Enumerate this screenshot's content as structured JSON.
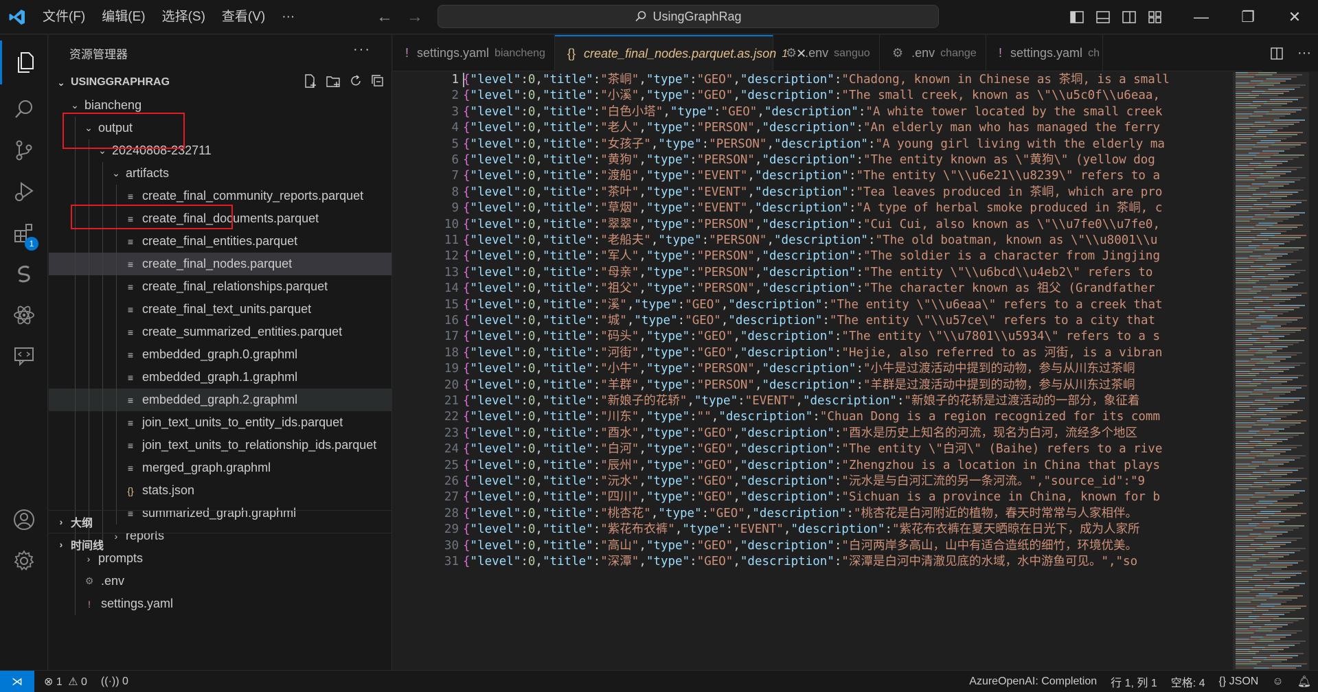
{
  "titlebar": {
    "menu": [
      "文件(F)",
      "编辑(E)",
      "选择(S)",
      "查看(V)",
      "···"
    ],
    "search_text": "UsingGraphRag"
  },
  "activity_bar": {
    "items": [
      "explorer-icon",
      "search-icon",
      "source-control-icon",
      "run-debug-icon",
      "extensions-icon",
      "remote-icon",
      "atom-icon",
      "comments-icon",
      "account-icon",
      "settings-gear-icon"
    ],
    "extensions_badge": "1",
    "accent_color": "#0078d4"
  },
  "sidebar": {
    "title": "资源管理器",
    "more": "···",
    "root": "USINGGRAPHRAG",
    "tree": [
      {
        "label": "biancheng",
        "type": "folder-open",
        "depth": 1
      },
      {
        "label": "output",
        "type": "folder-open",
        "depth": 2
      },
      {
        "label": "20240808-232711",
        "type": "folder-open",
        "depth": 3
      },
      {
        "label": "artifacts",
        "type": "folder-open",
        "depth": 4
      },
      {
        "label": "create_final_community_reports.parquet",
        "type": "file",
        "depth": 5
      },
      {
        "label": "create_final_documents.parquet",
        "type": "file",
        "depth": 5
      },
      {
        "label": "create_final_entities.parquet",
        "type": "file",
        "depth": 5
      },
      {
        "label": "create_final_nodes.parquet",
        "type": "file",
        "depth": 5,
        "selected": true
      },
      {
        "label": "create_final_relationships.parquet",
        "type": "file",
        "depth": 5
      },
      {
        "label": "create_final_text_units.parquet",
        "type": "file",
        "depth": 5
      },
      {
        "label": "create_summarized_entities.parquet",
        "type": "file",
        "depth": 5
      },
      {
        "label": "embedded_graph.0.graphml",
        "type": "file",
        "depth": 5
      },
      {
        "label": "embedded_graph.1.graphml",
        "type": "file",
        "depth": 5
      },
      {
        "label": "embedded_graph.2.graphml",
        "type": "file",
        "depth": 5,
        "hover": true
      },
      {
        "label": "join_text_units_to_entity_ids.parquet",
        "type": "file",
        "depth": 5
      },
      {
        "label": "join_text_units_to_relationship_ids.parquet",
        "type": "file",
        "depth": 5
      },
      {
        "label": "merged_graph.graphml",
        "type": "file",
        "depth": 5
      },
      {
        "label": "stats.json",
        "type": "json",
        "depth": 5
      },
      {
        "label": "summarized_graph.graphml",
        "type": "file",
        "depth": 5
      },
      {
        "label": "reports",
        "type": "folder-closed",
        "depth": 4
      },
      {
        "label": "prompts",
        "type": "folder-closed",
        "depth": 2
      },
      {
        "label": ".env",
        "type": "gear",
        "depth": 2
      },
      {
        "label": "settings.yaml",
        "type": "yaml",
        "depth": 2
      }
    ],
    "outline": "大纲",
    "timeline": "时间线"
  },
  "tabs": [
    {
      "icon": "!",
      "label": "settings.yaml",
      "desc": "biancheng",
      "active": false
    },
    {
      "icon": "{}",
      "label": "create_final_nodes.parquet.as.json",
      "desc": "1",
      "active": true
    },
    {
      "icon": "⚙",
      "label": ".env",
      "desc": "sanguo",
      "active": false
    },
    {
      "icon": "⚙",
      "label": ".env",
      "desc": "change",
      "active": false
    },
    {
      "icon": "!",
      "label": "settings.yaml",
      "desc": "ch",
      "active": false
    }
  ],
  "editor": {
    "lines": [
      {
        "n": "1",
        "title": "茶峒",
        "type": "GEO",
        "desc": "Chadong, known in Chinese as 茶垌, is a small"
      },
      {
        "n": "2",
        "title": "小溪",
        "type": "GEO",
        "desc": "The small creek, known as \\\"\\\\u5c0f\\\\u6eaa,"
      },
      {
        "n": "3",
        "title": "白色小塔",
        "type": "GEO",
        "desc": "A white tower located by the small creek"
      },
      {
        "n": "4",
        "title": "老人",
        "type": "PERSON",
        "desc": "An elderly man who has managed the ferry"
      },
      {
        "n": "5",
        "title": "女孩子",
        "type": "PERSON",
        "desc": "A young girl living with the elderly ma"
      },
      {
        "n": "6",
        "title": "黄狗",
        "type": "PERSON",
        "desc": "The entity known as \\\"黄狗\\\" (yellow dog"
      },
      {
        "n": "7",
        "title": "渡船",
        "type": "EVENT",
        "desc": "The entity \\\"\\\\u6e21\\\\u8239\\\" refers to a"
      },
      {
        "n": "8",
        "title": "茶叶",
        "type": "EVENT",
        "desc": "Tea leaves produced in 茶峒, which are pro"
      },
      {
        "n": "9",
        "title": "草烟",
        "type": "EVENT",
        "desc": "A type of herbal smoke produced in 茶峒, c"
      },
      {
        "n": "10",
        "title": "翠翠",
        "type": "PERSON",
        "desc": "Cui Cui, also known as \\\"\\\\u7fe0\\\\u7fe0,"
      },
      {
        "n": "11",
        "title": "老船夫",
        "type": "PERSON",
        "desc": "The old boatman, known as \\\"\\\\u8001\\\\u"
      },
      {
        "n": "12",
        "title": "军人",
        "type": "PERSON",
        "desc": "The soldier is a character from Jingjing"
      },
      {
        "n": "13",
        "title": "母亲",
        "type": "PERSON",
        "desc": "The entity \\\"\\\\u6bcd\\\\u4eb2\\\" refers to"
      },
      {
        "n": "14",
        "title": "祖父",
        "type": "PERSON",
        "desc": "The character known as 祖父 (Grandfather"
      },
      {
        "n": "15",
        "title": "溪",
        "type": "GEO",
        "desc": "The entity \\\"\\\\u6eaa\\\" refers to a creek that"
      },
      {
        "n": "16",
        "title": "城",
        "type": "GEO",
        "desc": "The entity \\\"\\\\u57ce\\\" refers to a city that"
      },
      {
        "n": "17",
        "title": "码头",
        "type": "GEO",
        "desc": "The entity \\\"\\\\u7801\\\\u5934\\\" refers to a s"
      },
      {
        "n": "18",
        "title": "河街",
        "type": "GEO",
        "desc": "Hejie, also referred to as 河街, is a vibran"
      },
      {
        "n": "19",
        "title": "小牛",
        "type": "PERSON",
        "desc": "小牛是过渡活动中提到的动物，参与从川东过茶峒"
      },
      {
        "n": "20",
        "title": "羊群",
        "type": "PERSON",
        "desc": "羊群是过渡活动中提到的动物，参与从川东过茶峒"
      },
      {
        "n": "21",
        "title": "新娘子的花轿",
        "type": "EVENT",
        "desc": "新娘子的花轿是过渡活动的一部分，象征着"
      },
      {
        "n": "22",
        "title": "川东",
        "type": "",
        "desc": "Chuan Dong is a region recognized for its comm"
      },
      {
        "n": "23",
        "title": "酉水",
        "type": "GEO",
        "desc": "酉水是历史上知名的河流，现名为白河，流经多个地区"
      },
      {
        "n": "24",
        "title": "白河",
        "type": "GEO",
        "desc": "The entity \\\"白河\\\" (Baihe) refers to a rive"
      },
      {
        "n": "25",
        "title": "辰州",
        "type": "GEO",
        "desc": "Zhengzhou is a location in China that plays"
      },
      {
        "n": "26",
        "title": "沅水",
        "type": "GEO",
        "desc": "沅水是与白河汇流的另一条河流。\",\"source_id\":\"9"
      },
      {
        "n": "27",
        "title": "四川",
        "type": "GEO",
        "desc": "Sichuan is a province in China, known for b"
      },
      {
        "n": "28",
        "title": "桃杏花",
        "type": "GEO",
        "desc": "桃杏花是白河附近的植物，春天时常常与人家相伴。"
      },
      {
        "n": "29",
        "title": "紫花布衣裤",
        "type": "EVENT",
        "desc": "紫花布衣裤在夏天晒晾在日光下，成为人家所"
      },
      {
        "n": "30",
        "title": "高山",
        "type": "GEO",
        "desc": "白河两岸多高山，山中有适合造纸的细竹，环境优美。"
      },
      {
        "n": "31",
        "title": "深潭",
        "type": "GEO",
        "desc": "深潭是白河中清澈见底的水域，水中游鱼可见。\",\"so"
      }
    ]
  },
  "statusbar": {
    "errors": "1",
    "warnings": "0",
    "ports": "0",
    "mode": "AzureOpenAI: Completion",
    "position": "行 1, 列 1",
    "spaces": "空格: 4",
    "language": "JSON",
    "lang_icon": "{}"
  }
}
